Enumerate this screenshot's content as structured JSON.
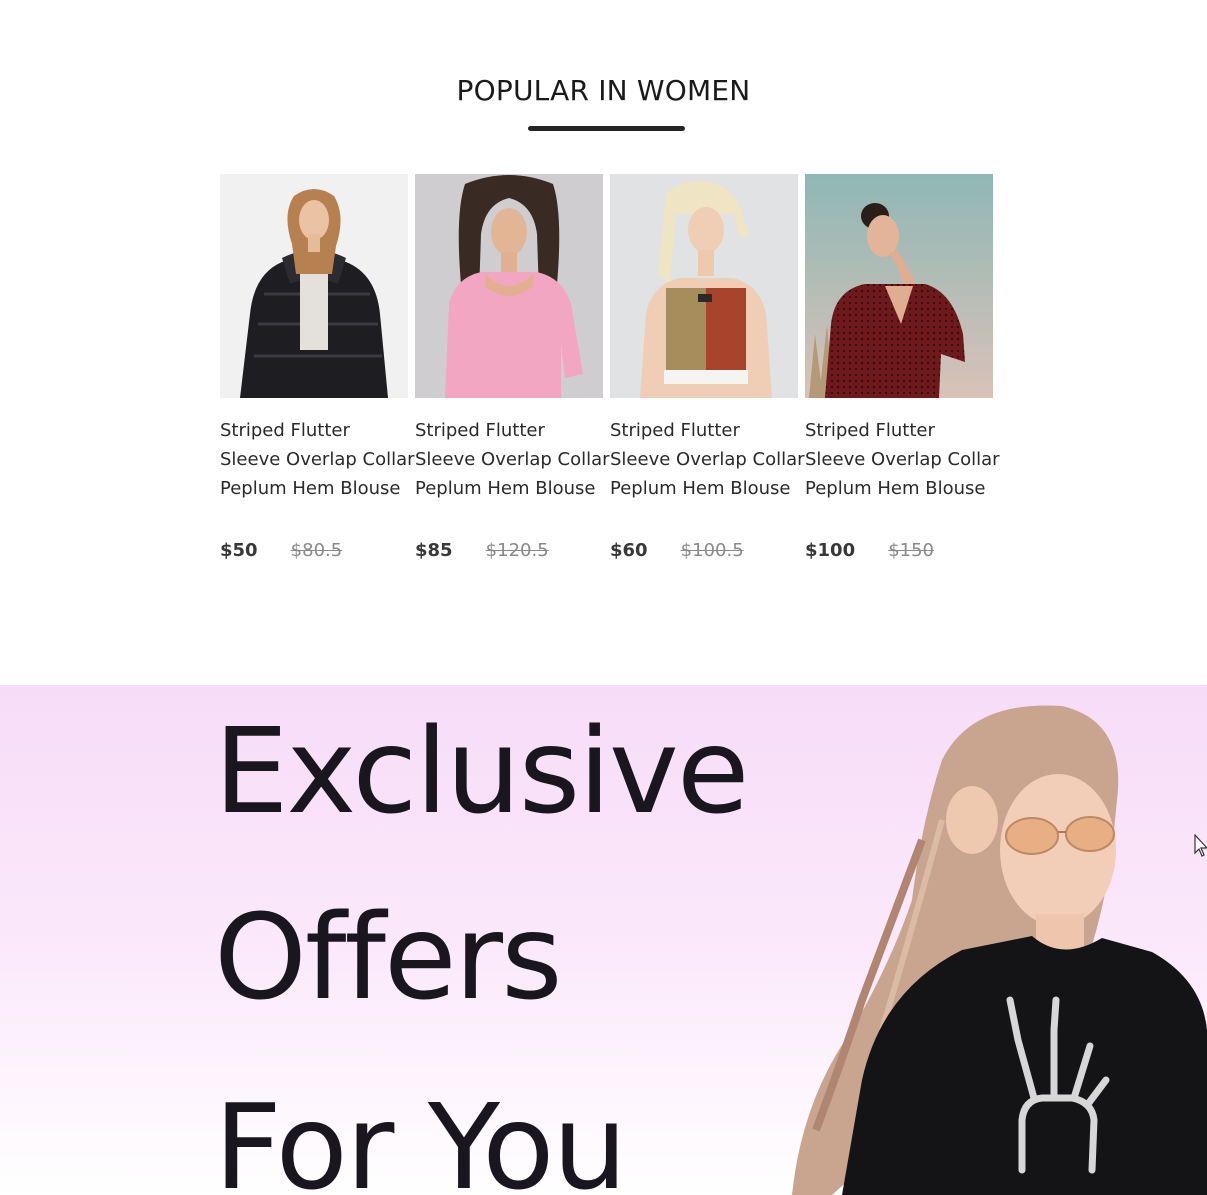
{
  "popular": {
    "title": "POPULAR IN WOMEN",
    "products": [
      {
        "name": "Striped Flutter Sleeve Overlap Collar Peplum Hem Blouse",
        "new_price": "$50",
        "old_price": "$80.5",
        "image": "woman-black-puffer-jacket-icon"
      },
      {
        "name": "Striped Flutter Sleeve Overlap Collar Peplum Hem Blouse",
        "new_price": "$85",
        "old_price": "$120.5",
        "image": "woman-pink-top-icon"
      },
      {
        "name": "Striped Flutter Sleeve Overlap Collar Peplum Hem Blouse",
        "new_price": "$60",
        "old_price": "$100.5",
        "image": "woman-sports-bra-icon"
      },
      {
        "name": "Striped Flutter Sleeve Overlap Collar Peplum Hem Blouse",
        "new_price": "$100",
        "old_price": "$150",
        "image": "woman-red-dotted-blouse-icon"
      }
    ]
  },
  "offers": {
    "lines": [
      "Exclusive",
      "Offers",
      "For You"
    ],
    "image": "woman-black-tshirt-sunglasses-icon"
  },
  "colors": {
    "banner_top": "#f7dcf8",
    "banner_bottom": "#ffffff",
    "text": "#1a1620",
    "underline": "#252525",
    "old_price": "#8a8a8a"
  }
}
